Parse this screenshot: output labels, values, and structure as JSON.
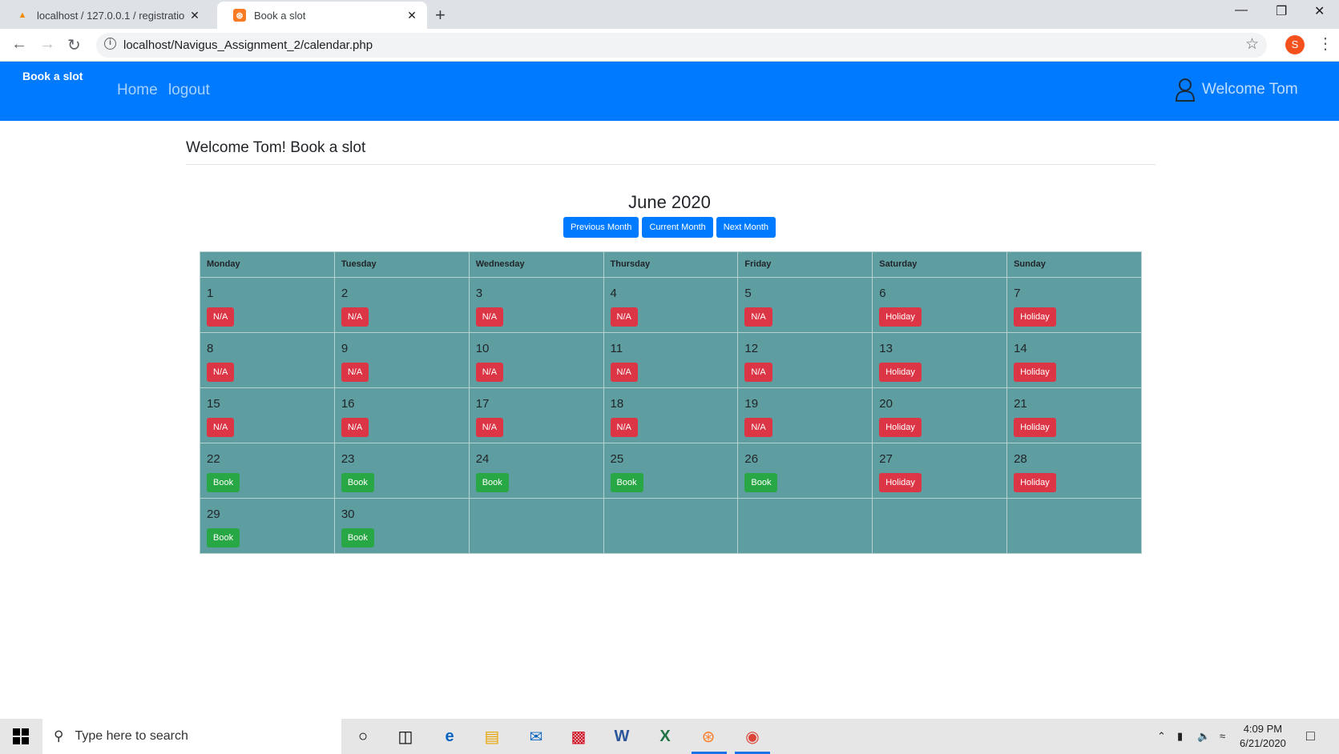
{
  "browser": {
    "tabs": [
      {
        "title": "localhost / 127.0.0.1 / registratio",
        "icon": "phpmyadmin-icon"
      },
      {
        "title": "Book a slot",
        "icon": "xampp-icon"
      }
    ],
    "url": "localhost/Navigus_Assignment_2/calendar.php",
    "profile_initial": "S"
  },
  "navbar": {
    "brand": "Book a slot",
    "links": [
      "Home",
      "logout"
    ],
    "welcome": "Welcome Tom"
  },
  "page": {
    "title": "Welcome Tom! Book a slot",
    "month": "June 2020",
    "buttons": {
      "previous": "Previous Month",
      "current": "Current Month",
      "next": "Next Month"
    }
  },
  "calendar": {
    "weekdays": [
      "Monday",
      "Tuesday",
      "Wednesday",
      "Thursday",
      "Friday",
      "Saturday",
      "Sunday"
    ],
    "weeks": [
      [
        {
          "day": "1",
          "status": "N/A"
        },
        {
          "day": "2",
          "status": "N/A"
        },
        {
          "day": "3",
          "status": "N/A"
        },
        {
          "day": "4",
          "status": "N/A"
        },
        {
          "day": "5",
          "status": "N/A"
        },
        {
          "day": "6",
          "status": "Holiday"
        },
        {
          "day": "7",
          "status": "Holiday"
        }
      ],
      [
        {
          "day": "8",
          "status": "N/A"
        },
        {
          "day": "9",
          "status": "N/A"
        },
        {
          "day": "10",
          "status": "N/A"
        },
        {
          "day": "11",
          "status": "N/A"
        },
        {
          "day": "12",
          "status": "N/A"
        },
        {
          "day": "13",
          "status": "Holiday"
        },
        {
          "day": "14",
          "status": "Holiday"
        }
      ],
      [
        {
          "day": "15",
          "status": "N/A"
        },
        {
          "day": "16",
          "status": "N/A"
        },
        {
          "day": "17",
          "status": "N/A"
        },
        {
          "day": "18",
          "status": "N/A"
        },
        {
          "day": "19",
          "status": "N/A"
        },
        {
          "day": "20",
          "status": "Holiday"
        },
        {
          "day": "21",
          "status": "Holiday"
        }
      ],
      [
        {
          "day": "22",
          "status": "Book"
        },
        {
          "day": "23",
          "status": "Book"
        },
        {
          "day": "24",
          "status": "Book"
        },
        {
          "day": "25",
          "status": "Book"
        },
        {
          "day": "26",
          "status": "Book"
        },
        {
          "day": "27",
          "status": "Holiday"
        },
        {
          "day": "28",
          "status": "Holiday"
        }
      ],
      [
        {
          "day": "29",
          "status": "Book"
        },
        {
          "day": "30",
          "status": "Book"
        },
        null,
        null,
        null,
        null,
        null
      ]
    ]
  },
  "taskbar": {
    "search_placeholder": "Type here to search",
    "time": "4:09 PM",
    "date": "6/21/2020"
  }
}
